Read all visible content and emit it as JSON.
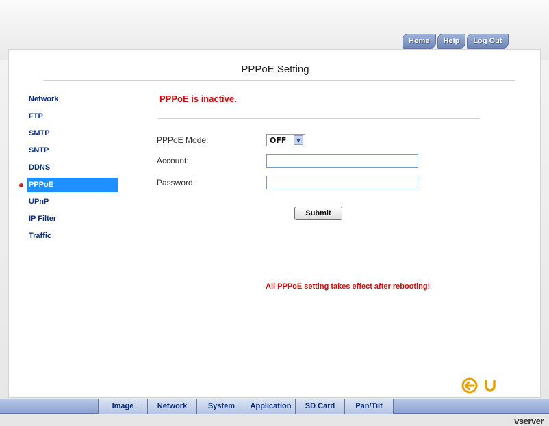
{
  "top_nav": [
    "Home",
    "Help",
    "Log Out"
  ],
  "page_title": "PPPoE Setting",
  "sidebar": {
    "items": [
      {
        "label": "Network"
      },
      {
        "label": "FTP"
      },
      {
        "label": "SMTP"
      },
      {
        "label": "SNTP"
      },
      {
        "label": "DDNS"
      },
      {
        "label": "PPPoE"
      },
      {
        "label": "UPnP"
      },
      {
        "label": "IP Filter"
      },
      {
        "label": "Traffic"
      }
    ],
    "active_index": 5
  },
  "status_message": "PPPoE is inactive.",
  "form": {
    "mode_label": "PPPoE Mode:",
    "mode_value": "OFF",
    "account_label": "Account:",
    "account_value": "",
    "password_label": "Password :",
    "password_value": "",
    "submit_label": "Submit"
  },
  "note": "All PPPoE setting takes effect after rebooting!",
  "bottom_tabs": [
    "Image",
    "Network",
    "System",
    "Application",
    "SD Card",
    "Pan/Tilt"
  ],
  "brand": "vserver",
  "colors": {
    "accent": "#1e90ff",
    "warning": "#d01010",
    "nav_text": "#0b2f7a",
    "back_icons": "#e8a000"
  },
  "icons": [
    "back-arrow-icon",
    "refresh-icon",
    "bullet-icon"
  ]
}
